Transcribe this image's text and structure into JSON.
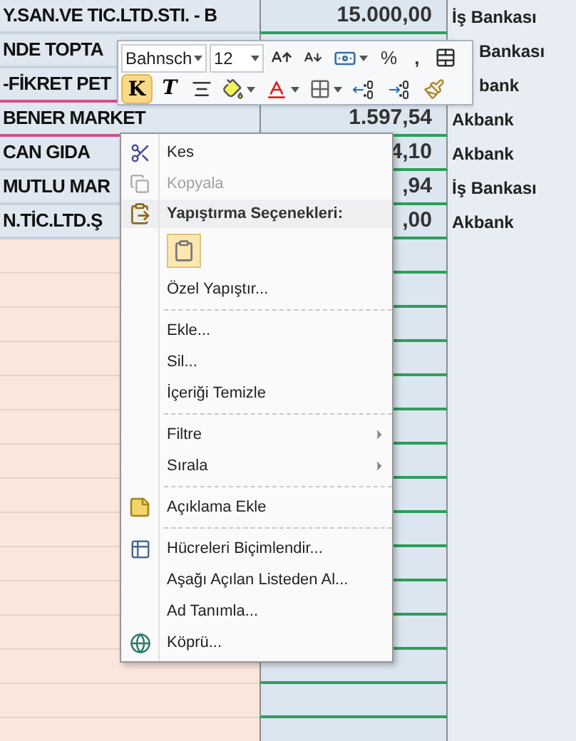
{
  "sheet": {
    "rows": [
      {
        "name": "Y.SAN.VE TIC.LTD.STI. - B",
        "amount": "15.000,00",
        "bank": "İş Bankası"
      },
      {
        "name": "NDE TOPTA",
        "bank": "Bankası"
      },
      {
        "name": "-FİKRET PET",
        "bank": "bank"
      },
      {
        "name": "BENER MARKET",
        "amount": "1.597,54",
        "bank": "Akbank"
      },
      {
        "name": "CAN GIDA",
        "amount": "4,10",
        "bank": "Akbank"
      },
      {
        "name": "MUTLU MAR",
        "amount": ",94",
        "bank": "İş Bankası"
      },
      {
        "name": "N.TİC.LTD.Ş",
        "amount": ",00",
        "bank": "Akbank"
      }
    ]
  },
  "mini_toolbar": {
    "font": "Bahnsch",
    "size": "12",
    "percent": "%",
    "comma": ",",
    "bold": {
      "label": "K",
      "selected": true
    },
    "italic": {
      "label": "T",
      "selected": false
    }
  },
  "context_menu": {
    "items": [
      {
        "kind": "item",
        "label": "Kes",
        "disabled": false
      },
      {
        "kind": "item",
        "label": "Kopyala",
        "disabled": true
      },
      {
        "kind": "header",
        "label": "Yapıştırma Seçenekleri:"
      },
      {
        "kind": "paste"
      },
      {
        "kind": "item",
        "label": "Özel Yapıştır...",
        "disabled": false
      },
      {
        "kind": "separator"
      },
      {
        "kind": "item",
        "label": "Ekle...",
        "disabled": false
      },
      {
        "kind": "item",
        "label": "Sil...",
        "disabled": false
      },
      {
        "kind": "item",
        "label": "İçeriği Temizle",
        "disabled": false
      },
      {
        "kind": "separator"
      },
      {
        "kind": "submenu",
        "label": "Filtre",
        "disabled": false
      },
      {
        "kind": "submenu",
        "label": "Sırala",
        "disabled": false
      },
      {
        "kind": "separator"
      },
      {
        "kind": "item",
        "label": "Açıklama Ekle",
        "disabled": false
      },
      {
        "kind": "separator"
      },
      {
        "kind": "item",
        "label": "Hücreleri Biçimlendir...",
        "disabled": false
      },
      {
        "kind": "item",
        "label": "Aşağı Açılan Listeden Al...",
        "disabled": false
      },
      {
        "kind": "item",
        "label": "Ad Tanımla...",
        "disabled": false
      },
      {
        "kind": "item",
        "label": "Köprü...",
        "disabled": false
      }
    ]
  }
}
